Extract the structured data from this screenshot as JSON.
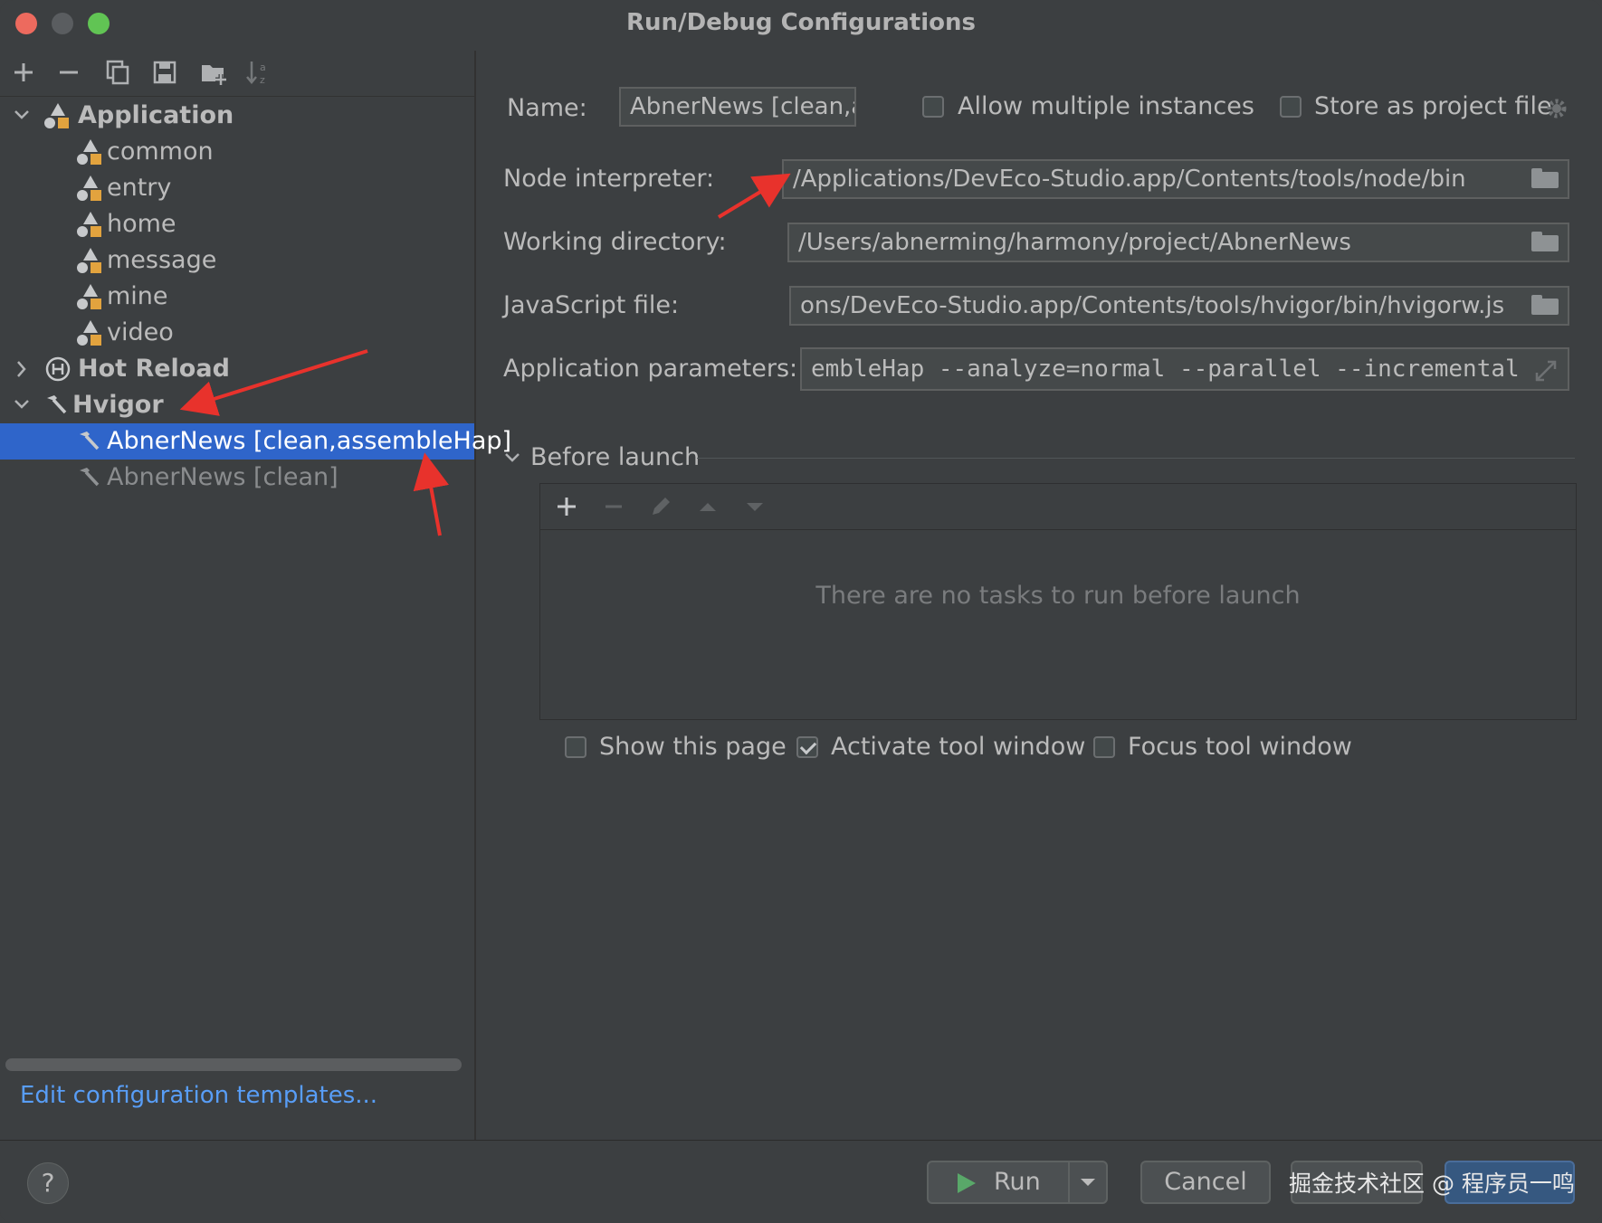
{
  "window": {
    "title": "Run/Debug Configurations"
  },
  "toolbar": {
    "icons": [
      "add-icon",
      "remove-icon",
      "copy-icon",
      "save-icon",
      "new-folder-icon",
      "sort-icon"
    ]
  },
  "tree": {
    "application": {
      "label": "Application",
      "children": [
        "common",
        "entry",
        "home",
        "message",
        "mine",
        "video"
      ]
    },
    "hot_reload": {
      "label": "Hot Reload"
    },
    "hvigor": {
      "label": "Hvigor",
      "children": [
        "AbnerNews [clean,assembleHap]",
        "AbnerNews [clean]"
      ]
    }
  },
  "edit_templates_link": "Edit configuration templates...",
  "form": {
    "name_label": "Name:",
    "name_value": "AbnerNews [clean,a",
    "allow_multiple_label": "Allow multiple instances",
    "allow_multiple_checked": false,
    "store_project_label": "Store as project file",
    "store_project_checked": false,
    "node_interpreter_label": "Node interpreter:",
    "node_interpreter_value": "/Applications/DevEco-Studio.app/Contents/tools/node/bin",
    "working_dir_label": "Working directory:",
    "working_dir_value": "/Users/abnerming/harmony/project/AbnerNews",
    "js_file_label": "JavaScript file:",
    "js_file_value": "ons/DevEco-Studio.app/Contents/tools/hvigor/bin/hvigorw.js",
    "app_params_label": "Application parameters:",
    "app_params_value": "embleHap --analyze=normal --parallel --incremental"
  },
  "before_launch": {
    "title": "Before launch",
    "empty_text": "There are no tasks to run before launch",
    "toolbar_icons": [
      "add-icon",
      "remove-icon",
      "edit-icon",
      "move-up-icon",
      "move-down-icon"
    ]
  },
  "options": {
    "show_page_label": "Show this page",
    "show_page_checked": false,
    "activate_tool_label": "Activate tool window",
    "activate_tool_checked": true,
    "focus_tool_label": "Focus tool window",
    "focus_tool_checked": false
  },
  "buttons": {
    "help": "?",
    "run": "Run",
    "cancel": "Cancel"
  },
  "watermark": "掘金技术社区 @ 程序员一鸣",
  "colors": {
    "background": "#3c3f41",
    "selection": "#2f65ca",
    "link": "#589df6",
    "annotation_arrow": "#e8322c",
    "run_icon": "#59a869"
  }
}
